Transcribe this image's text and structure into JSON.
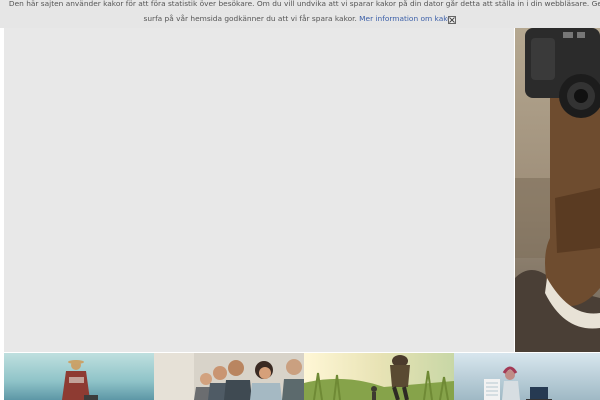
{
  "cookie_banner": {
    "text_line1": "Den här sajten använder kakor för att föra statistik över besökare. Om du vill undvika att vi sparar kakor på din dator går detta att ställa in i din webbläsare. Genom att fortsätta",
    "text_line2": "surfa på vår hemsida godkänner du att vi får spara kakor.",
    "link_text": "Mer information om kakor.",
    "close_icon": "close-icon"
  },
  "images": {
    "hero": "camera-and-boot-photo",
    "thumbnails": [
      "person-sitting-by-sea-photo",
      "group-of-people-photo",
      "hiker-in-grass-photo",
      "person-at-laptop-photo"
    ]
  },
  "colors": {
    "banner_bg": "#e6e6e6",
    "banner_text": "#555555",
    "link": "#3b5fa8",
    "panel_bg": "#e8e8e8"
  }
}
